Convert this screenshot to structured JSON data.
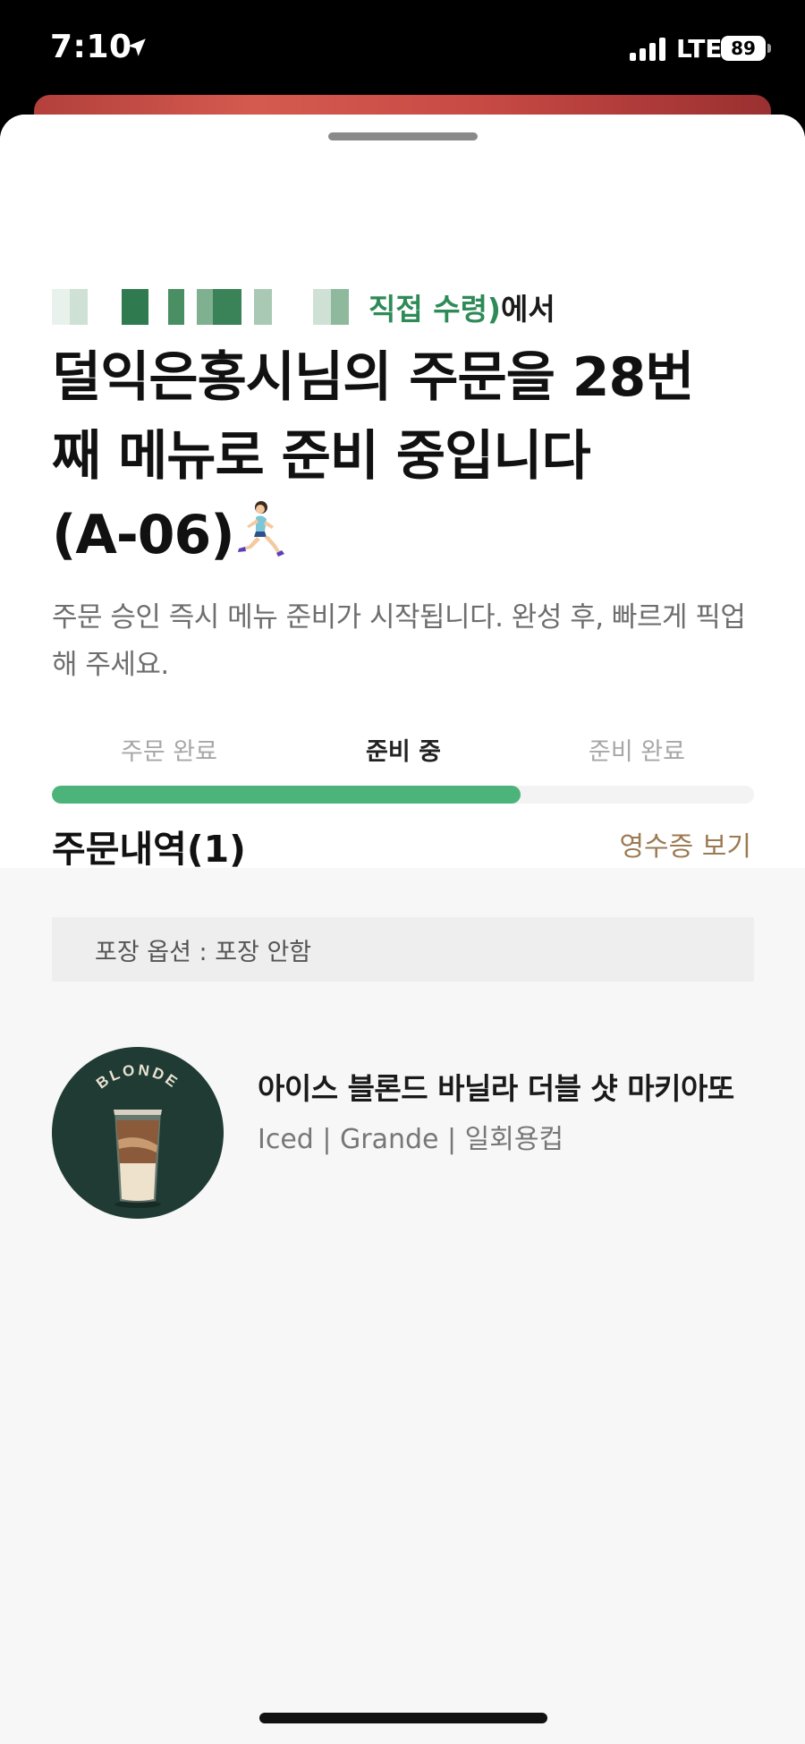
{
  "status_bar": {
    "time": "7:10",
    "network": "LTE",
    "battery": "89"
  },
  "header": {
    "store_suffix_green": "직접 수령)",
    "store_suffix": "에서",
    "headline_line1": "덜익은홍시님의 주문을 28번",
    "headline_line2": "째 메뉴로 준비 중입니다",
    "headline_line3": "(A-06)",
    "subtext": "주문 승인 즉시 메뉴 준비가 시작됩니다. 완성 후, 빠르게 픽업해 주세요."
  },
  "progress": {
    "steps": [
      "주문 완료",
      "준비 중",
      "준비 완료"
    ],
    "active_index": 1,
    "fill_percent": 66.7,
    "fill_color": "#4cb47a"
  },
  "order": {
    "title": "주문내역(1)",
    "receipt_label": "영수증 보기",
    "packaging_option": "포장 옵션 : 포장 안함",
    "items": [
      {
        "name": "아이스 블론드 바닐라 더블 샷 마키아또",
        "options": "Iced | Grande | 일회용컵",
        "badge_text": "BLONDE"
      }
    ]
  },
  "colors": {
    "accent_green": "#2e8a57",
    "receipt_link": "#9c7a52",
    "item_image_bg": "#1f3b33"
  }
}
